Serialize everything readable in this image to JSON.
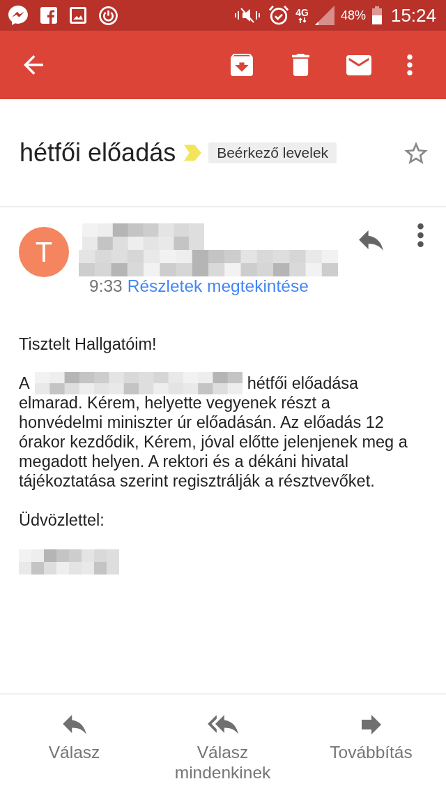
{
  "status_bar": {
    "network": "4G",
    "battery": "48%",
    "time": "15:24"
  },
  "subject": {
    "title": "hétfői előadás",
    "important": true,
    "label": "Beérkező levelek",
    "starred": false
  },
  "message": {
    "avatar_letter": "T",
    "time": "9:33",
    "details_link": "Részletek megtekintése"
  },
  "body": [
    {
      "kind": "text",
      "text": "Tisztelt Hallgatóim!"
    },
    {
      "kind": "redacted_lead",
      "before": "A",
      "after": "hétfői előadása",
      "continuation": "elmarad. Kérem, helyette vegyenek részt a honvédelmi miniszter úr előadásán. Az előadás 12 órakor kezdődik, Kérem, jóval előtte jelenjenek meg a megadott helyen. A rektori és a dékáni hivatal tájékoztatása szerint regisztrálják a résztvevőket."
    },
    {
      "kind": "text",
      "text": "Üdvözlettel:"
    },
    {
      "kind": "redacted"
    }
  ],
  "actions": [
    {
      "kind": "reply",
      "label": "Válasz"
    },
    {
      "kind": "reply_all",
      "label": "Válasz mindenkinek"
    },
    {
      "kind": "forward",
      "label": "Továbbítás"
    }
  ]
}
